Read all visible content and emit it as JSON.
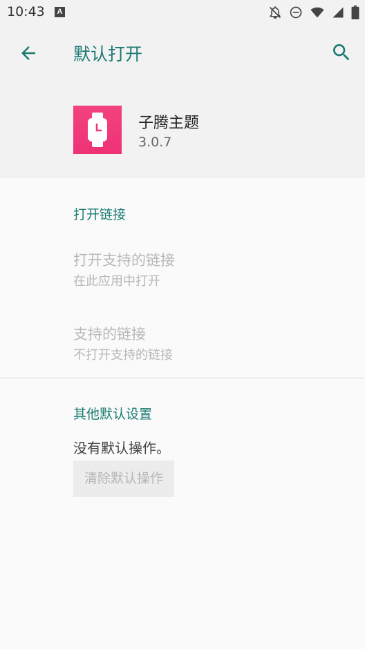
{
  "status_bar": {
    "time": "10:43",
    "notification_icon": "A",
    "icons": [
      "notifications-off-icon",
      "do-not-disturb-icon",
      "wifi-icon",
      "cell-signal-icon",
      "battery-icon"
    ]
  },
  "toolbar": {
    "back_icon": "arrow-back-icon",
    "title": "默认打开",
    "search_icon": "search-icon"
  },
  "app": {
    "name": "子腾主题",
    "version": "3.0.7",
    "icon_color": "#ef3779"
  },
  "open_links": {
    "header": "打开链接",
    "open_supported_title": "打开支持的链接",
    "open_supported_value": "在此应用中打开",
    "supported_links_title": "支持的链接",
    "supported_links_value": "不打开支持的链接"
  },
  "other_defaults": {
    "header": "其他默认设置",
    "no_defaults": "没有默认操作。",
    "clear_button": "清除默认操作"
  },
  "colors": {
    "accent": "#1a7a72",
    "disabled_text": "#b8b8b8"
  }
}
